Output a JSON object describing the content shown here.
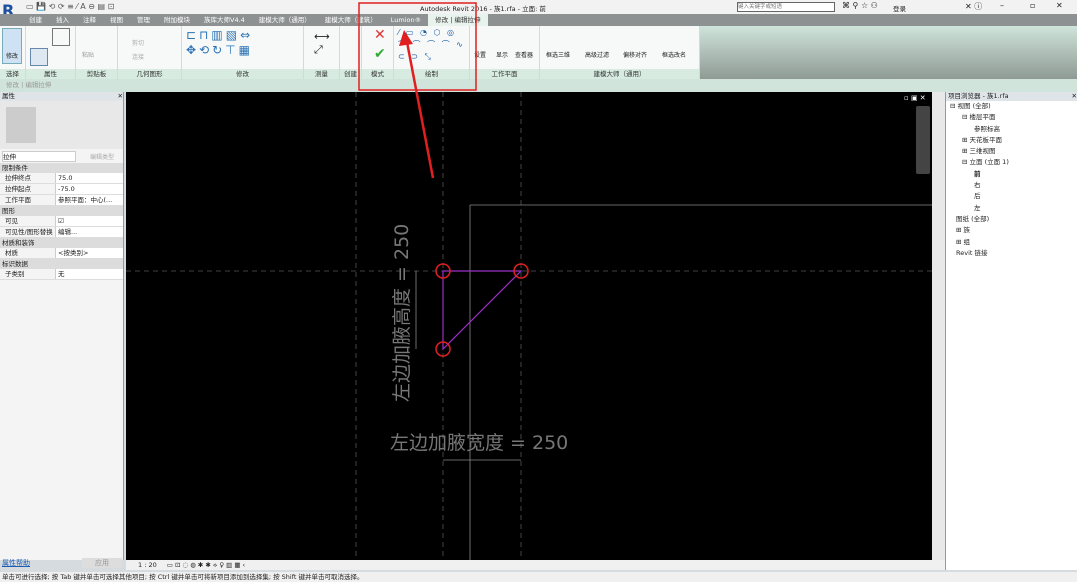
{
  "title": "Autodesk Revit 2016 -    族1.rfa - 立面: 前",
  "search_placeholder": "键入关键字或短语",
  "login": "登录",
  "tabs": [
    "创建",
    "插入",
    "注释",
    "视图",
    "管理",
    "附加模块",
    "族库大师V4.4",
    "建模大师（通用）",
    "建模大师（建筑）",
    "Lumion®",
    "修改 | 编辑拉伸"
  ],
  "panels": {
    "select": "选择",
    "modify_btn": "修改",
    "properties": "属性",
    "clipboard": "剪贴板",
    "paste": "粘贴",
    "geometry": "几何图形",
    "cut": "剪切",
    "join": "连接",
    "modify": "修改",
    "measure": "测量",
    "create": "创建",
    "mode": "模式",
    "draw": "绘制",
    "workplane": "工作平面",
    "set": "设置",
    "show": "显示",
    "viewer": "查看器",
    "jmds": "建模大师（通用）",
    "btn1": "框选三维",
    "btn2": "高级过滤",
    "btn3": "偏移对齐",
    "btn4": "框选改名"
  },
  "optbar": "修改 | 编辑拉伸",
  "properties": {
    "title": "属性",
    "type": "拉伸",
    "edit_type": "编辑类型",
    "groups": [
      {
        "name": "限制条件",
        "rows": [
          [
            "拉伸终点",
            "75.0"
          ],
          [
            "拉伸起点",
            "-75.0"
          ],
          [
            "工作平面",
            "参照平面：中心(..."
          ]
        ]
      },
      {
        "name": "图形",
        "rows": [
          [
            "可见",
            "☑"
          ],
          [
            "可见性/图形替换",
            "编辑..."
          ]
        ]
      },
      {
        "name": "材质和装饰",
        "rows": [
          [
            "材质",
            "<按类别>"
          ]
        ]
      },
      {
        "name": "标识数据",
        "rows": [
          [
            "子类别",
            "无"
          ]
        ]
      }
    ],
    "help": "属性帮助",
    "apply": "应用"
  },
  "browser": {
    "title": "项目浏览器 - 族1.rfa",
    "items": [
      "视图 (全部)",
      "楼层平面",
      "参照标高",
      "天花板平面",
      "三维视图",
      "立面 (立面 1)",
      "前",
      "右",
      "后",
      "左",
      "图纸 (全部)",
      "族",
      "组",
      "Revit 链接"
    ]
  },
  "canvas": {
    "dim_height": "左边加腋高度 = 250",
    "dim_width": "左边加腋宽度 = 250"
  },
  "viewbar": {
    "scale": "1 : 20"
  },
  "status": "单击可进行选择; 按 Tab 键并单击可选择其他项目; 按 Ctrl 键并单击可将新项目添加到选择集; 按 Shift 键并单击可取消选择。",
  "colors": {
    "annotation": "#e02020",
    "sketch": "#9b30c8",
    "tab_active": "#e7f3ec"
  }
}
